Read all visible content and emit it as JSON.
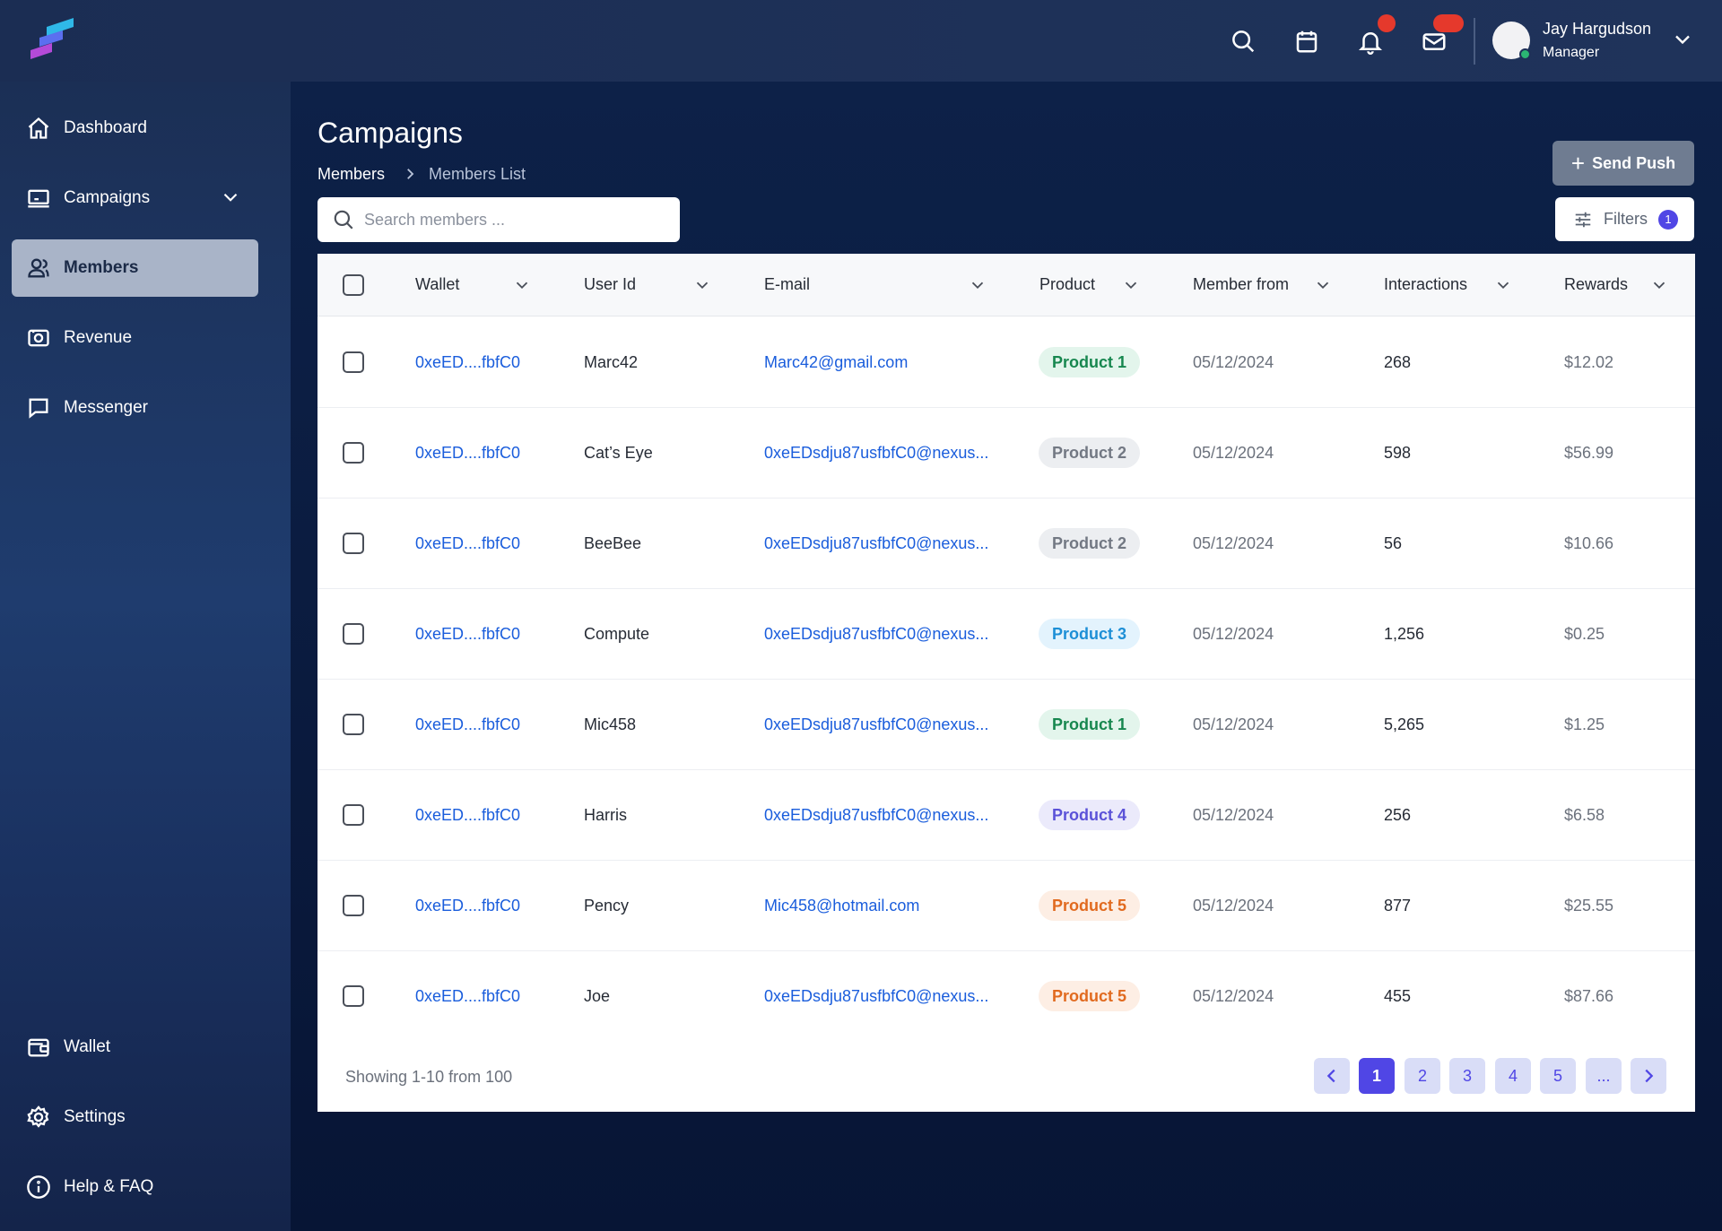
{
  "header": {
    "user_name": "Jay Hargudson",
    "user_role": "Manager",
    "colors": {
      "notification_badge": "#e5392c",
      "online": "#2bb673"
    },
    "icons": [
      "search-icon",
      "calendar-icon",
      "bell-icon",
      "mail-icon",
      "chevron-down-icon"
    ]
  },
  "sidebar": {
    "items": [
      {
        "label": "Dashboard",
        "icon": "home-icon"
      },
      {
        "label": "Campaigns",
        "icon": "laptop-icon"
      },
      {
        "label": "Members",
        "icon": "users-icon",
        "active": true
      },
      {
        "label": "Revenue",
        "icon": "cash-icon"
      },
      {
        "label": "Messenger",
        "icon": "chat-icon"
      }
    ],
    "bottom_items": [
      {
        "label": "Wallet",
        "icon": "wallet-icon"
      },
      {
        "label": "Settings",
        "icon": "gear-icon"
      },
      {
        "label": "Help & FAQ",
        "icon": "info-icon"
      }
    ],
    "active_color": "#a9b4c8"
  },
  "page": {
    "title": "Campaigns",
    "breadcrumb": [
      "Members",
      "Members List"
    ],
    "search_placeholder": "Search members ...",
    "send_push_label": "Send Push",
    "filters_label": "Filters",
    "filters_count": "1"
  },
  "table": {
    "columns": [
      "Wallet",
      "User Id",
      "E-mail",
      "Product",
      "Member from",
      "Interactions",
      "Rewards"
    ],
    "rows": [
      {
        "wallet": "0xeED....fbfC0",
        "user": "Marc42",
        "email": "Marc42@gmail.com",
        "product": "Product 1",
        "product_color": "green",
        "from": "05/12/2024",
        "interactions": "268",
        "rewards": "$12.02"
      },
      {
        "wallet": "0xeED....fbfC0",
        "user": "Cat’s Eye",
        "email": "0xeEDsdju87usfbfC0@nexus...",
        "product": "Product 2",
        "product_color": "gray",
        "from": "05/12/2024",
        "interactions": "598",
        "rewards": "$56.99"
      },
      {
        "wallet": "0xeED....fbfC0",
        "user": "BeeBee",
        "email": "0xeEDsdju87usfbfC0@nexus...",
        "product": "Product 2",
        "product_color": "gray",
        "from": "05/12/2024",
        "interactions": "56",
        "rewards": "$10.66"
      },
      {
        "wallet": "0xeED....fbfC0",
        "user": "Compute",
        "email": "0xeEDsdju87usfbfC0@nexus...",
        "product": "Product 3",
        "product_color": "blue",
        "from": "05/12/2024",
        "interactions": "1,256",
        "rewards": "$0.25"
      },
      {
        "wallet": "0xeED....fbfC0",
        "user": "Mic458",
        "email": "0xeEDsdju87usfbfC0@nexus...",
        "product": "Product 1",
        "product_color": "green",
        "from": "05/12/2024",
        "interactions": "5,265",
        "rewards": "$1.25"
      },
      {
        "wallet": "0xeED....fbfC0",
        "user": "Harris",
        "email": "0xeEDsdju87usfbfC0@nexus...",
        "product": "Product 4",
        "product_color": "purple",
        "from": "05/12/2024",
        "interactions": "256",
        "rewards": "$6.58"
      },
      {
        "wallet": "0xeED....fbfC0",
        "user": "Pency",
        "email": "Mic458@hotmail.com",
        "product": "Product 5",
        "product_color": "orange",
        "from": "05/12/2024",
        "interactions": "877",
        "rewards": "$25.55"
      },
      {
        "wallet": "0xeED....fbfC0",
        "user": "Joe",
        "email": "0xeEDsdju87usfbfC0@nexus...",
        "product": "Product 5",
        "product_color": "orange",
        "from": "05/12/2024",
        "interactions": "455",
        "rewards": "$87.66"
      }
    ],
    "product_colors": {
      "green": {
        "bg": "#e3f5ec",
        "fg": "#17874f"
      },
      "gray": {
        "bg": "#eceef1",
        "fg": "#727883"
      },
      "blue": {
        "bg": "#e3f3fd",
        "fg": "#1d8fd6"
      },
      "purple": {
        "bg": "#ebeafb",
        "fg": "#5b52d8"
      },
      "orange": {
        "bg": "#fdeee4",
        "fg": "#e16a1f"
      }
    }
  },
  "footer": {
    "showing": "Showing 1-10 from 100",
    "pages": [
      "1",
      "2",
      "3",
      "4",
      "5",
      "..."
    ],
    "active_page": "1",
    "accent": "#5046e5"
  }
}
